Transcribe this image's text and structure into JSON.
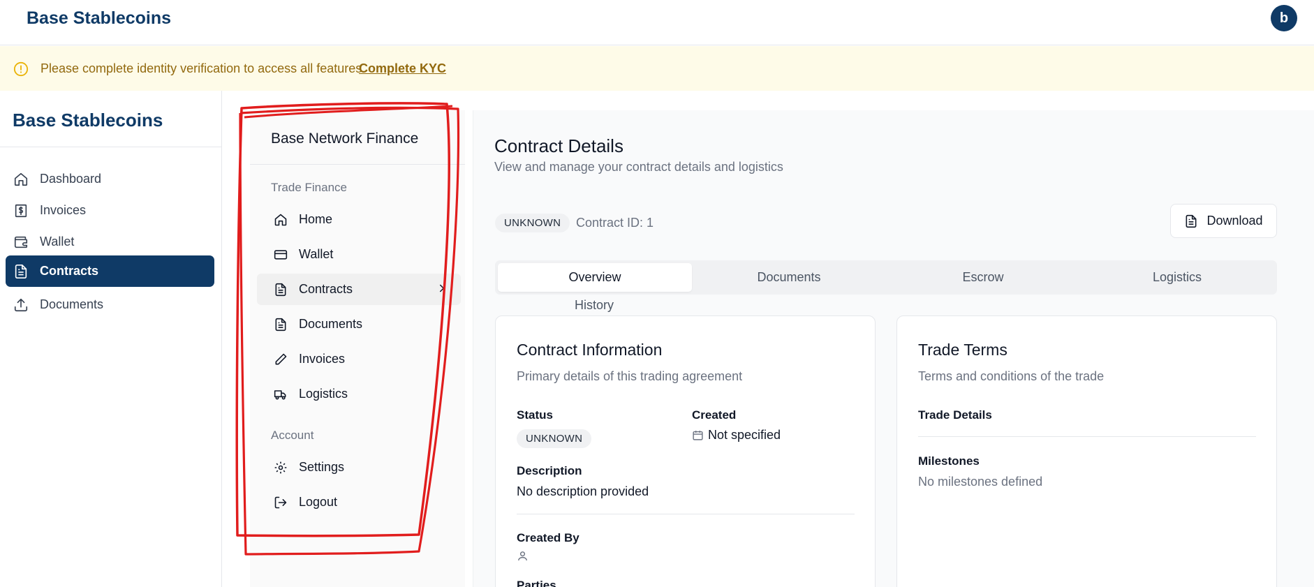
{
  "topbar": {
    "brand": "Base Stablecoins",
    "avatar_letter": "b"
  },
  "banner": {
    "message": "Please complete identity verification to access all features.",
    "action": "Complete KYC",
    "color": "#92690e"
  },
  "sidebar": {
    "title": "Base Stablecoins",
    "items": [
      {
        "label": "Dashboard",
        "icon": "home-icon"
      },
      {
        "label": "Invoices",
        "icon": "dollar-receipt-icon"
      },
      {
        "label": "Wallet",
        "icon": "wallet-icon"
      },
      {
        "label": "Contracts",
        "icon": "file-text-icon",
        "active": true
      },
      {
        "label": "Documents",
        "icon": "upload-icon"
      }
    ]
  },
  "subnav": {
    "header": "Base Network Finance",
    "group_trade": "Trade Finance",
    "group_account": "Account",
    "items": [
      {
        "label": "Home",
        "icon": "home-icon"
      },
      {
        "label": "Wallet",
        "icon": "credit-card-icon"
      },
      {
        "label": "Contracts",
        "icon": "file-text-icon",
        "active": true
      },
      {
        "label": "Documents",
        "icon": "file-text-icon"
      },
      {
        "label": "Invoices",
        "icon": "pencil-icon"
      },
      {
        "label": "Logistics",
        "icon": "truck-icon"
      },
      {
        "label": "Settings",
        "icon": "gear-icon"
      },
      {
        "label": "Logout",
        "icon": "logout-icon"
      }
    ]
  },
  "main": {
    "title": "Contract Details",
    "subtitle": "View and manage your contract details and logistics",
    "status_badge": "UNKNOWN",
    "contract_id": "Contract ID: 1",
    "download_label": "Download",
    "tabs": [
      "Overview",
      "Documents",
      "Escrow",
      "Logistics",
      "History"
    ],
    "active_tab": "Overview"
  },
  "contract_info": {
    "title": "Contract Information",
    "subtitle": "Primary details of this trading agreement",
    "status_label": "Status",
    "status_value": "UNKNOWN",
    "created_label": "Created",
    "created_value": "Not specified",
    "description_label": "Description",
    "description_value": "No description provided",
    "created_by_label": "Created By",
    "parties_label": "Parties"
  },
  "trade_terms": {
    "title": "Trade Terms",
    "subtitle": "Terms and conditions of the trade",
    "details_label": "Trade Details",
    "milestones_label": "Milestones",
    "milestones_value": "No milestones defined"
  },
  "colors": {
    "brand": "#0f3a66",
    "annotation": "#e11d1d",
    "banner_bg": "#fefbe8"
  }
}
